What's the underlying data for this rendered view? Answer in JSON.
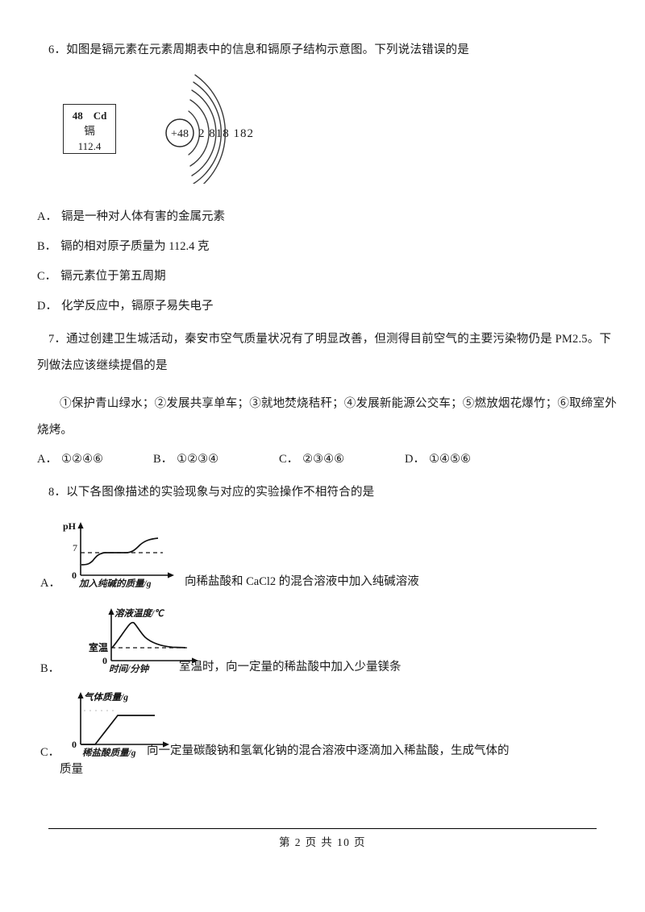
{
  "page": {
    "footer": "第 2 页 共 10 页"
  },
  "questions": [
    {
      "number": "6",
      "stem": "6．如图是镉元素在元素周期表中的信息和镉原子结构示意图。下列说法错误的是",
      "element_card": {
        "atomic_number": "48",
        "symbol": "Cd",
        "name": "镉",
        "atomic_mass": "112.4"
      },
      "atom_diagram": {
        "nucleus": "+48",
        "shells": "2 818 182",
        "shell_counts": [
          2,
          8,
          18,
          18,
          2
        ],
        "shell_arc_count": 5
      },
      "options": [
        {
          "label": "A．",
          "text": "镉是一种对人体有害的金属元素"
        },
        {
          "label": "B．",
          "text": "镉的相对原子质量为 112.4 克"
        },
        {
          "label": "C．",
          "text": "镉元素位于第五周期"
        },
        {
          "label": "D．",
          "text": "化学反应中，镉原子易失电子"
        }
      ]
    },
    {
      "number": "7",
      "stem_line1": "7．通过创建卫生城活动，秦安市空气质量状况有了明显改善，但测得目前空气的主要污染物仍是 PM2.5。下",
      "stem_line2": "列做法应该继续提倡的是",
      "items_line1": "①保护青山绿水；②发展共享单车；③就地焚烧秸秆；④发展新能源公交车；⑤燃放烟花爆竹；⑥取缔室外",
      "items_line2": "烧烤。",
      "options": [
        {
          "label": "A．",
          "text": "①②④⑥"
        },
        {
          "label": "B．",
          "text": "①②③④"
        },
        {
          "label": "C．",
          "text": "②③④⑥"
        },
        {
          "label": "D．",
          "text": "①④⑤⑥"
        }
      ]
    },
    {
      "number": "8",
      "stem": "8．以下各图像描述的实验现象与对应的实验操作不相符合的是",
      "options": [
        {
          "label": "A．",
          "description": "向稀盐酸和 CaCl2 的混合溶液中加入纯碱溶液",
          "description_wrap": "",
          "chart": {
            "type": "line",
            "ylabel": "pH",
            "xlabel": "加入纯碱的质量/g",
            "ytick": "7",
            "origin": "0",
            "dashed_level_label": "7",
            "shape": "rise-plateau-rise",
            "points": [
              [
                0,
                3.2
              ],
              [
                6,
                3.4
              ],
              [
                14,
                4.6
              ],
              [
                22,
                6.6
              ],
              [
                30,
                7.0
              ],
              [
                58,
                7.0
              ],
              [
                66,
                7.6
              ],
              [
                78,
                8.6
              ],
              [
                92,
                9.0
              ],
              [
                108,
                9.1
              ]
            ]
          }
        },
        {
          "label": "B．",
          "description": "室温时，向一定量的稀盐酸中加入少量镁条",
          "description_wrap": "",
          "chart": {
            "type": "line",
            "ylabel": "溶液温度/℃",
            "xlabel": "时间/分钟",
            "ytick": "室温",
            "origin": "0",
            "shape": "peak-decay",
            "points": [
              [
                0,
                0
              ],
              [
                8,
                14
              ],
              [
                18,
                30
              ],
              [
                26,
                42
              ],
              [
                32,
                48
              ],
              [
                40,
                36
              ],
              [
                52,
                22
              ],
              [
                68,
                12
              ],
              [
                84,
                5
              ],
              [
                100,
                1.5
              ],
              [
                118,
                0.5
              ]
            ]
          }
        },
        {
          "label": "C．",
          "description": "向一定量碳酸钠和氢氧化钠的混合溶液中逐滴加入稀盐酸，生成气体的",
          "description_wrap": "质量",
          "chart": {
            "type": "line",
            "ylabel": "气体质量/g",
            "xlabel": "稀盐酸质量/g",
            "origin": "0",
            "shape": "delay-linear-plateau",
            "points": [
              [
                0,
                0
              ],
              [
                16,
                0
              ],
              [
                44,
                34
              ],
              [
                100,
                34
              ]
            ]
          }
        }
      ]
    }
  ]
}
